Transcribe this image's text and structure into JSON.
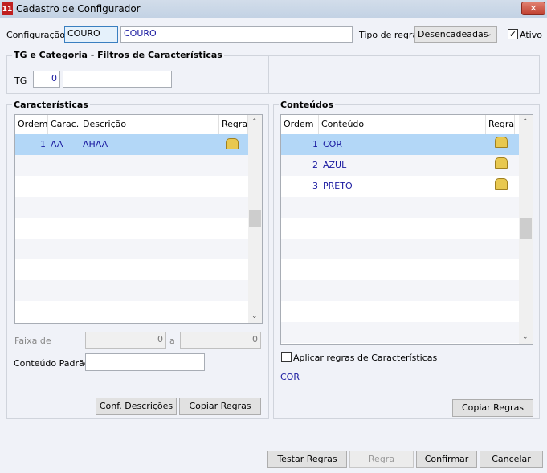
{
  "window": {
    "title": "Cadastro de Configurador",
    "close": "✕"
  },
  "top": {
    "config_label": "Configuração",
    "config_code": "COURO",
    "config_desc": "COURO",
    "tipo_label": "Tipo de regra",
    "tipo_value": "Desencadeadas",
    "ativo_label": "Ativo",
    "ativo_checked": true
  },
  "tg": {
    "group_title": "TG e Categoria - Filtros de Características",
    "label": "TG",
    "value": "0",
    "desc": ""
  },
  "caracteristicas": {
    "title": "Características",
    "headers": [
      "Ordem",
      "Carac.",
      "Descrição",
      "Regra"
    ],
    "rows": [
      {
        "ordem": "1",
        "carac": "AA",
        "descricao": "AHAA"
      }
    ],
    "faixa_label": "Faixa de",
    "faixa_from": "0",
    "faixa_a": "a",
    "faixa_to": "0",
    "padrao_label": "Conteúdo Padrão",
    "padrao_value": "",
    "conf_button": "Conf. Descrições",
    "copiar_button": "Copiar Regras"
  },
  "conteudos": {
    "title": "Conteúdos",
    "headers": [
      "Ordem",
      "Conteúdo",
      "Regra"
    ],
    "rows": [
      {
        "ordem": "1",
        "conteudo": "COR"
      },
      {
        "ordem": "2",
        "conteudo": "AZUL"
      },
      {
        "ordem": "3",
        "conteudo": "PRETO"
      }
    ],
    "aplicar_label": "Aplicar regras de Características",
    "selected": "COR",
    "copiar_button": "Copiar Regras"
  },
  "footer": {
    "testar": "Testar Regras",
    "regra": "Regra",
    "confirmar": "Confirmar",
    "cancelar": "Cancelar"
  }
}
